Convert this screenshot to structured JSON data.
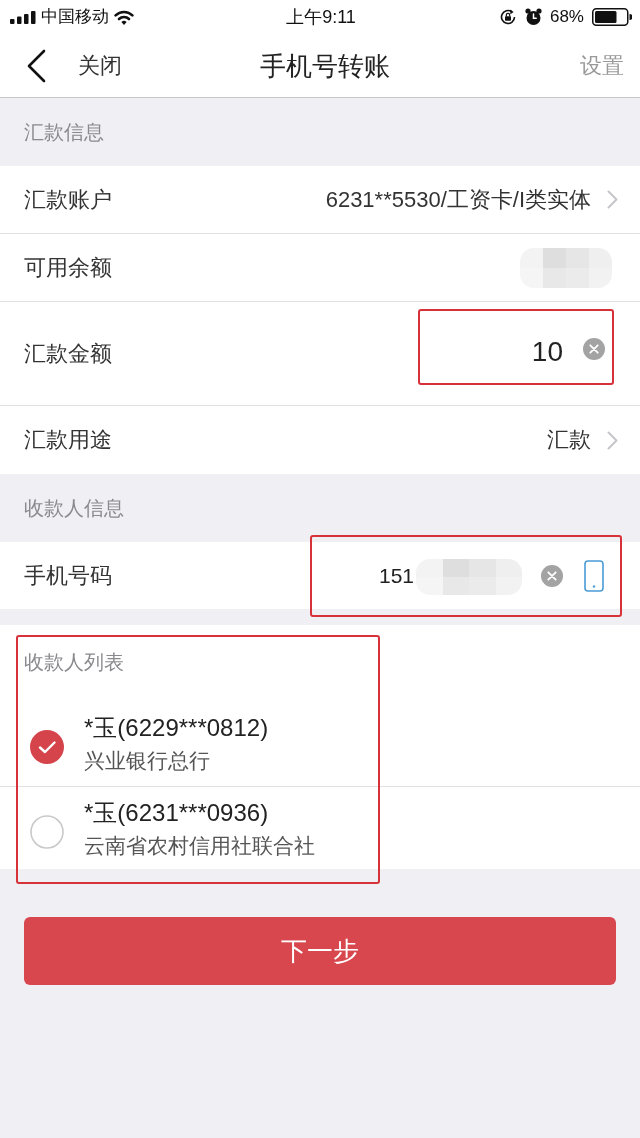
{
  "status_bar": {
    "carrier": "中国移动",
    "time": "上午9:11",
    "battery": "68%"
  },
  "nav": {
    "back": "关闭",
    "title": "手机号转账",
    "action": "设置"
  },
  "sections": [
    {
      "title": "汇款信息",
      "rows": [
        {
          "kind": "link",
          "label": "汇款账户",
          "value": "6231**5530/工资卡/I类实体"
        },
        {
          "kind": "redacted",
          "label": "可用余额"
        },
        {
          "kind": "input",
          "label": "汇款金额",
          "value": "10",
          "highlighted": true
        },
        {
          "kind": "link",
          "label": "汇款用途",
          "value": "汇款"
        }
      ]
    },
    {
      "title": "收款人信息",
      "rows": [
        {
          "kind": "phone",
          "label": "手机号码",
          "value": "151",
          "highlighted": true
        }
      ]
    }
  ],
  "payee_list": {
    "title": "收款人列表",
    "highlighted": true,
    "items": [
      {
        "name": "*玉(6229***0812)",
        "bank": "兴业银行总行",
        "selected": true
      },
      {
        "name": "*玉(6231***0936)",
        "bank": "云南省农村信用社联合社",
        "selected": false
      }
    ]
  },
  "next_button": "下一步"
}
